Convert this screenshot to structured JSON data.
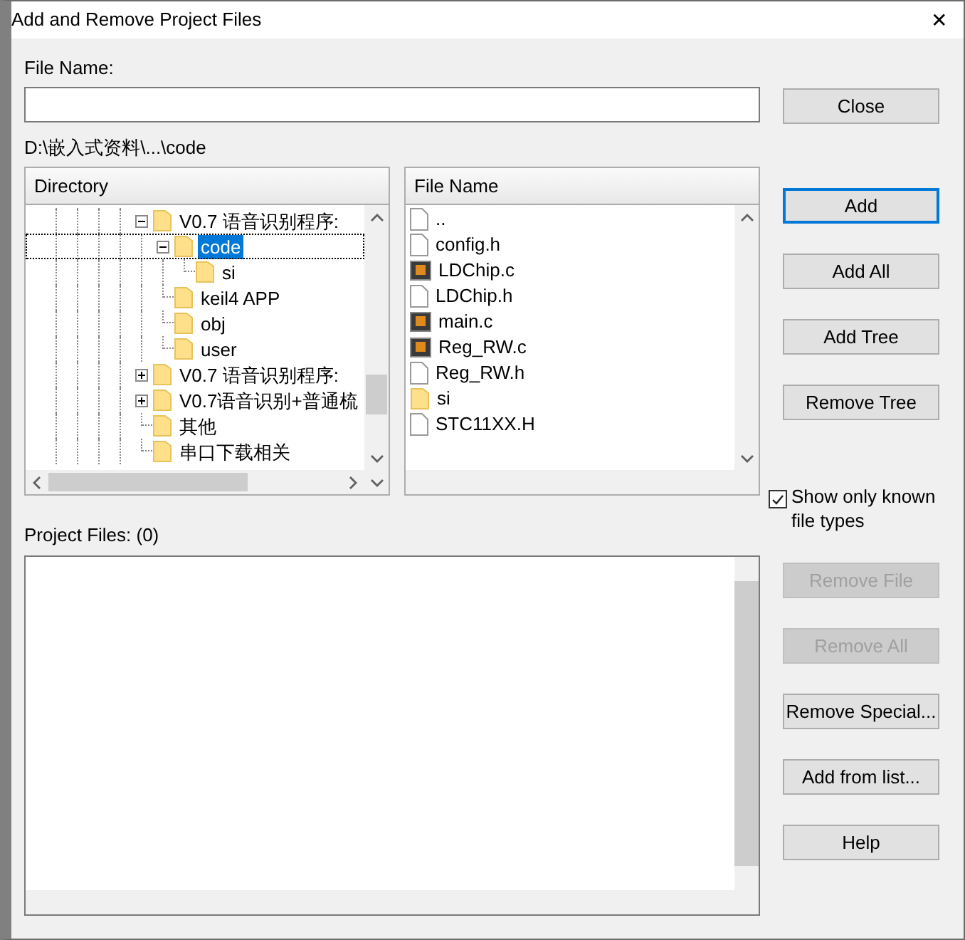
{
  "window": {
    "title": "Add and Remove Project Files",
    "close_glyph": "✕"
  },
  "file_name": {
    "label": "File Name:"
  },
  "path": "D:\\嵌入式资料\\...\\code",
  "directory": {
    "header": "Directory",
    "items": [
      {
        "children": [
          {
            "label": "V0.7 语音识别程序:",
            "expanded": true,
            "selected": false,
            "children": [
              {
                "label": "code",
                "expanded": true,
                "selected": true,
                "children": [
                  {
                    "label": "si",
                    "selected": false
                  }
                ]
              },
              {
                "label": "keil4 APP",
                "selected": false
              },
              {
                "label": "obj",
                "selected": false
              },
              {
                "label": "user",
                "selected": false
              }
            ]
          },
          {
            "label": "V0.7 语音识别程序:",
            "expanded": false,
            "selected": false
          },
          {
            "label": "V0.7语音识别+普通梳",
            "expanded": false,
            "selected": false
          },
          {
            "label": "其他",
            "selected": false
          }
        ]
      },
      {
        "label": "串口下载相关",
        "selected": false
      }
    ]
  },
  "files": {
    "header": "File Name",
    "items": [
      {
        "name": "..",
        "kind": "file"
      },
      {
        "name": "config.h",
        "kind": "file"
      },
      {
        "name": "LDChip.c",
        "kind": "source"
      },
      {
        "name": "LDChip.h",
        "kind": "file"
      },
      {
        "name": "main.c",
        "kind": "source"
      },
      {
        "name": "Reg_RW.c",
        "kind": "source"
      },
      {
        "name": "Reg_RW.h",
        "kind": "file"
      },
      {
        "name": "si",
        "kind": "folder"
      },
      {
        "name": "STC11XX.H",
        "kind": "file"
      }
    ]
  },
  "close_button": {
    "label": "Close",
    "disabled": false,
    "default": false
  },
  "top_buttons": [
    {
      "label": "Add",
      "disabled": false,
      "default": true
    },
    {
      "label": "Add All",
      "disabled": false,
      "default": false
    },
    {
      "label": "Add Tree",
      "disabled": false,
      "default": false
    },
    {
      "label": "Remove Tree",
      "disabled": false,
      "default": false
    }
  ],
  "known_types": {
    "label": "Show only known file types",
    "checked": true
  },
  "project_files": {
    "label": "Project Files: (0)"
  },
  "bottom_buttons": [
    {
      "label": "Remove File",
      "disabled": true,
      "default": false
    },
    {
      "label": "Remove All",
      "disabled": true,
      "default": false
    },
    {
      "label": "Remove Special...",
      "disabled": false,
      "default": false
    },
    {
      "label": "Add from list...",
      "disabled": false,
      "default": false
    },
    {
      "label": "Help",
      "disabled": false,
      "default": false
    }
  ]
}
